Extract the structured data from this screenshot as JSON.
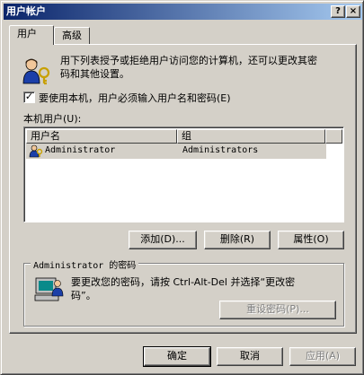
{
  "window": {
    "title": "用户帐户",
    "help_btn": "?",
    "close_btn": "×"
  },
  "tabs": [
    {
      "label": "用户",
      "active": true
    },
    {
      "label": "高级",
      "active": false
    }
  ],
  "intro": {
    "line1": "用下列表授予或拒绝用户访问您的计算机，还可以更改其密",
    "line2": "码和其他设置。"
  },
  "require_login": {
    "checked": true,
    "label": "要使用本机，用户必须输入用户名和密码(E)"
  },
  "local_users": {
    "label": "本机用户(U):",
    "columns": [
      "用户名",
      "组"
    ],
    "rows": [
      {
        "user": "Administrator",
        "group": "Administrators",
        "selected": true
      }
    ]
  },
  "list_buttons": {
    "add": "添加(D)...",
    "remove": "删除(R)",
    "properties": "属性(O)"
  },
  "password_group": {
    "label": "Administrator 的密码",
    "text_line1": "要更改您的密码，请按 Ctrl-Alt-Del 并选择“更改密",
    "text_line2": "码”。",
    "reset_button": "重设密码(P)..."
  },
  "dialog_buttons": {
    "ok": "确定",
    "cancel": "取消",
    "apply": "应用(A)"
  },
  "colors": {
    "face": "#d4d0c8",
    "title_start": "#0a246a",
    "title_end": "#a6caf0",
    "disabled_text": "#808080"
  }
}
